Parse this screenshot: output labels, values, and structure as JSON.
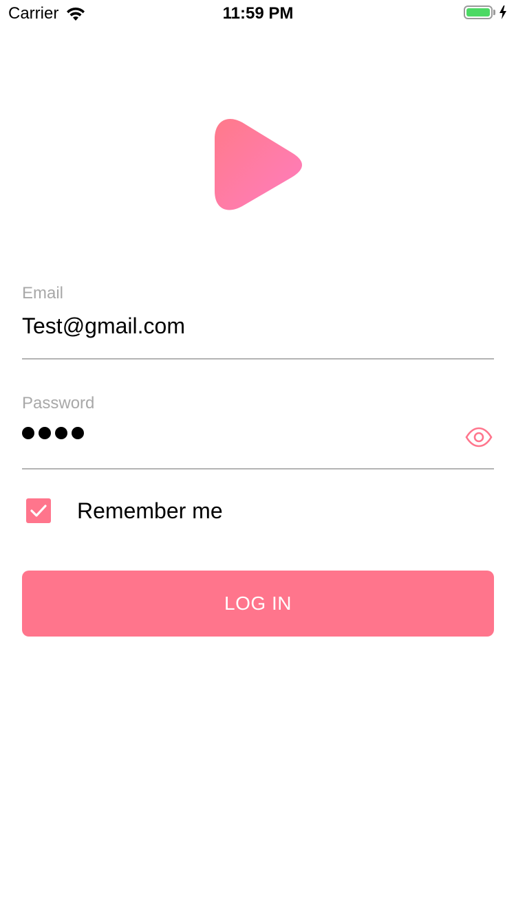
{
  "status_bar": {
    "carrier": "Carrier",
    "time": "11:59 PM",
    "battery_level": 1.0,
    "battery_color": "#4cd964",
    "charging": true
  },
  "logo": {
    "icon": "play-icon",
    "gradient_start": "#ff7a8a",
    "gradient_end": "#ff7dbf"
  },
  "email": {
    "label": "Email",
    "value": "Test@gmail.com"
  },
  "password": {
    "label": "Password",
    "masked_length": 4,
    "toggle_icon": "eye-icon"
  },
  "remember": {
    "label": "Remember me",
    "checked": true
  },
  "login": {
    "label": "LOG IN"
  },
  "colors": {
    "accent": "#ff758c",
    "divider": "#b3b3b3",
    "label": "#a8a8a8"
  }
}
